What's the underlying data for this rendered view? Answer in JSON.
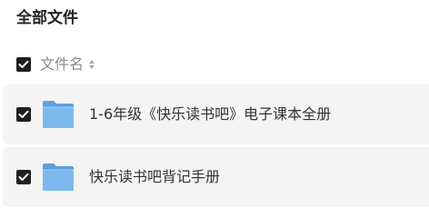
{
  "header": {
    "title": "全部文件"
  },
  "list": {
    "column_label": "文件名",
    "sort_icon": "sort-icon",
    "items": [
      {
        "name": "1-6年级《快乐读书吧》电子课本全册",
        "type": "folder",
        "checked": true
      },
      {
        "name": "快乐读书吧背记手册",
        "type": "folder",
        "checked": true
      }
    ]
  },
  "colors": {
    "checkbox": "#1f1f1f",
    "folder_main": "#7db9ee",
    "folder_back": "#5c9fe0",
    "row_background": "#f4f4f4"
  }
}
